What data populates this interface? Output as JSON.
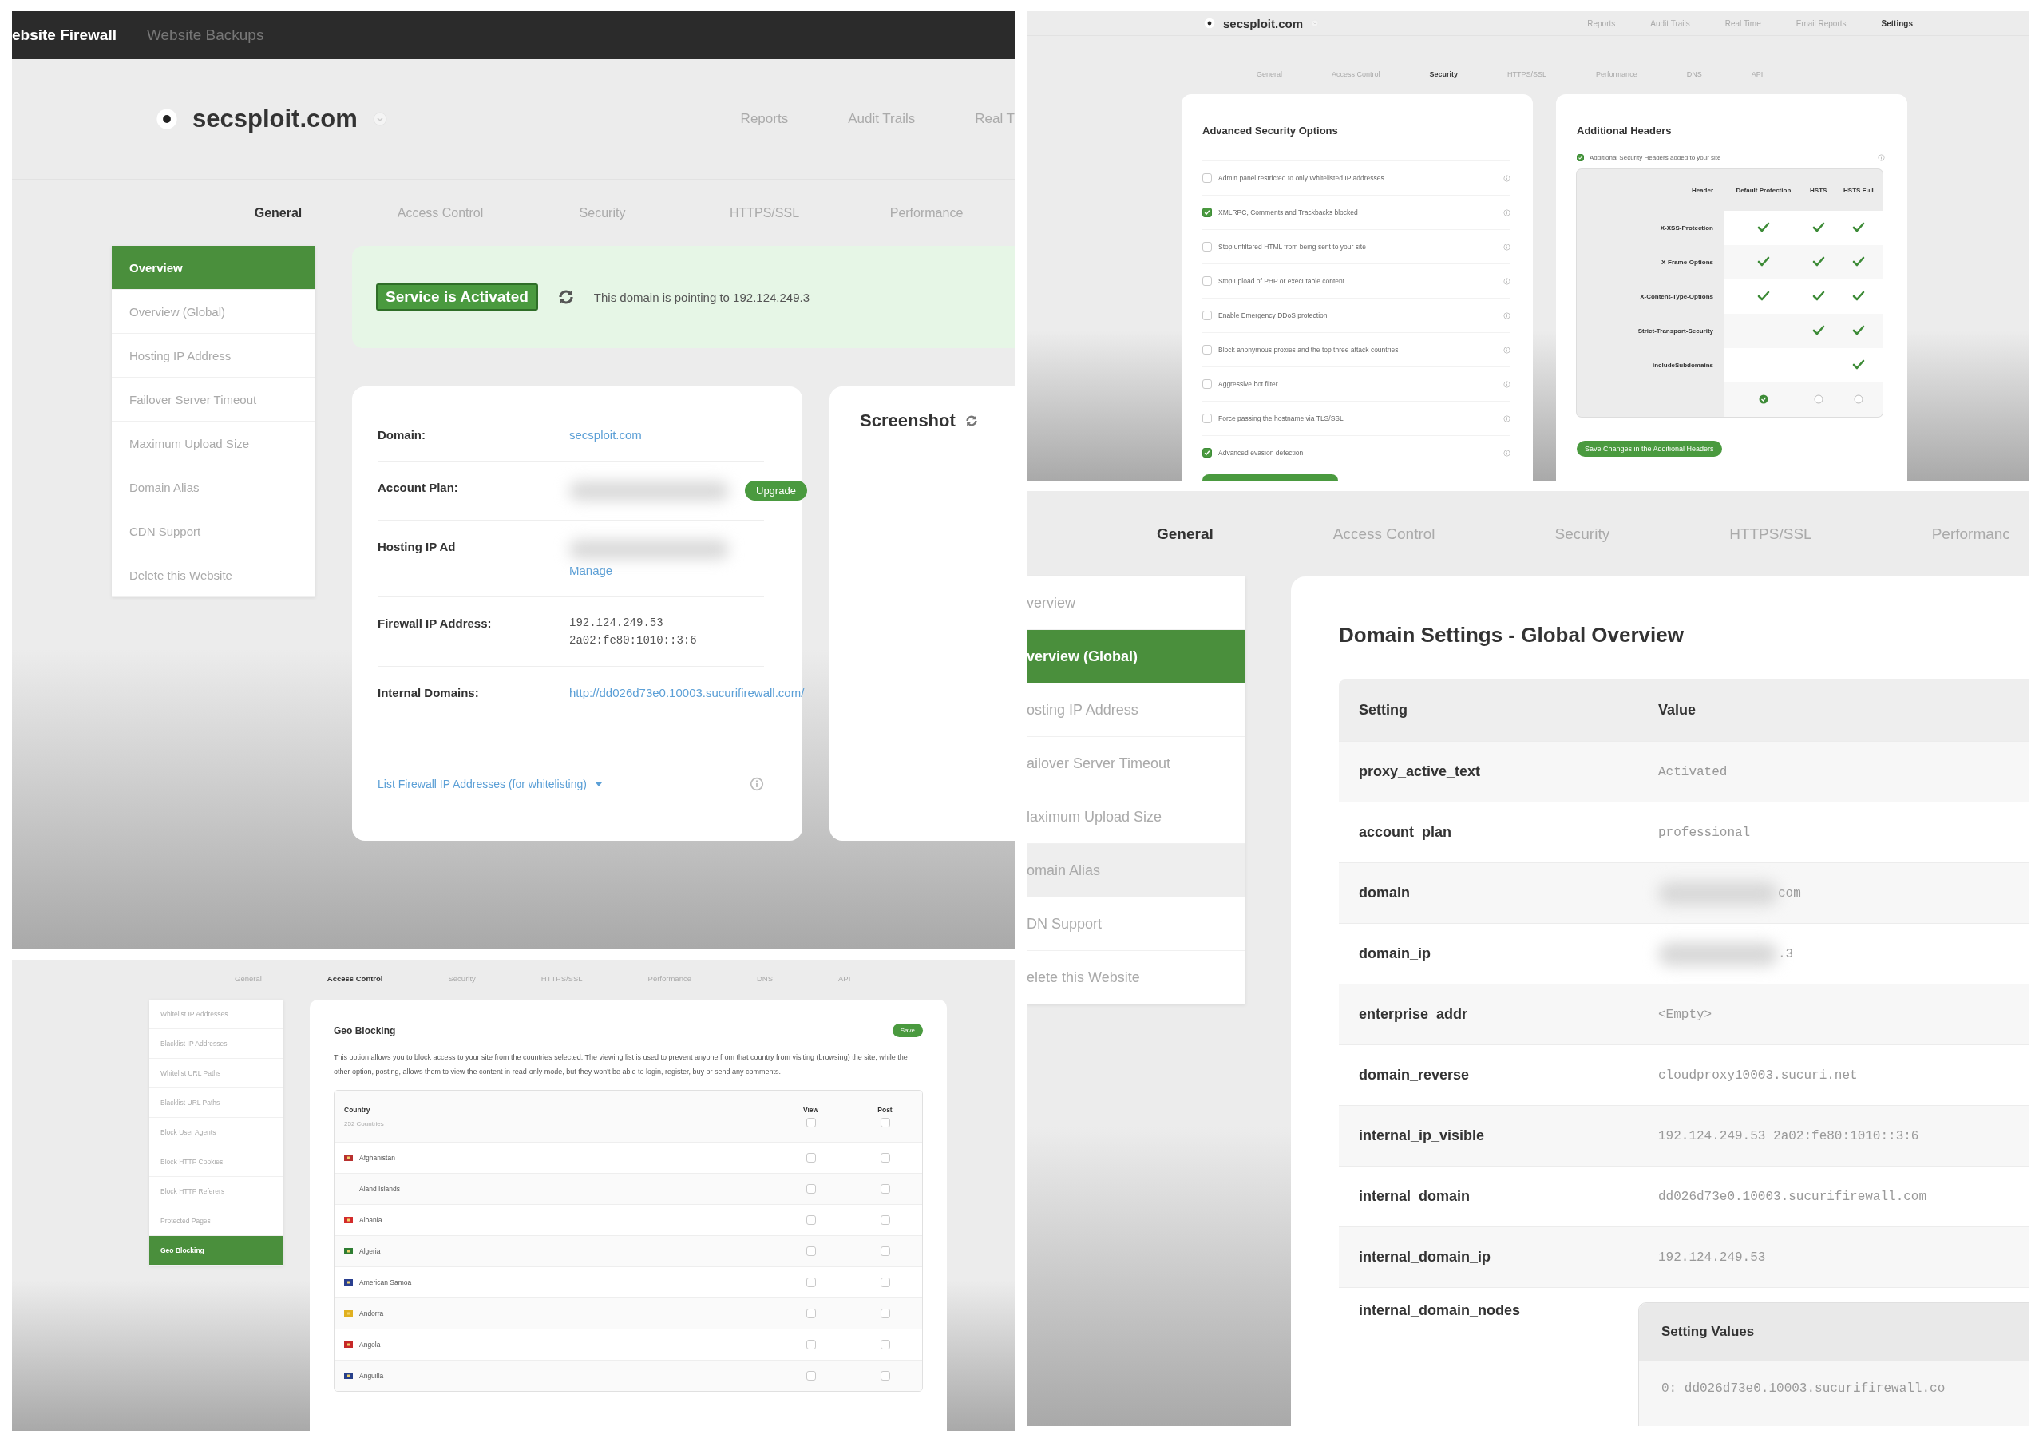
{
  "firewall_overview": {
    "top_bar": [
      {
        "label": "ebsite Firewall",
        "selected": true
      },
      {
        "label": "Website Backups",
        "selected": false
      }
    ],
    "site": "secsploit.com",
    "nav": [
      {
        "label": "Reports",
        "selected": false
      },
      {
        "label": "Audit Trails",
        "selected": false
      },
      {
        "label": "Real T",
        "selected": false
      }
    ],
    "tabs": [
      {
        "label": "General",
        "selected": true
      },
      {
        "label": "Access Control",
        "selected": false
      },
      {
        "label": "Security",
        "selected": false
      },
      {
        "label": "HTTPS/SSL",
        "selected": false
      },
      {
        "label": "Performance",
        "selected": false
      }
    ],
    "sidebar": [
      {
        "label": "Overview",
        "selected": true
      },
      {
        "label": "Overview (Global)",
        "selected": false
      },
      {
        "label": "Hosting IP Address",
        "selected": false
      },
      {
        "label": "Failover Server Timeout",
        "selected": false
      },
      {
        "label": "Maximum Upload Size",
        "selected": false
      },
      {
        "label": "Domain Alias",
        "selected": false
      },
      {
        "label": "CDN Support",
        "selected": false
      },
      {
        "label": "Delete this Website",
        "selected": false
      }
    ],
    "status": {
      "badge": "Service is Activated",
      "text": "This domain is pointing to 192.124.249.3"
    },
    "details": [
      {
        "label": "Domain:",
        "kind": "link",
        "value": "secsploit.com",
        "redacted": false
      },
      {
        "label": "Account Plan:",
        "kind": "button",
        "value": "Upgrade",
        "redacted": true
      },
      {
        "label": "Hosting IP Ad",
        "kind": "link",
        "value": "Manage",
        "redacted": true
      },
      {
        "label": "Firewall IP Address:",
        "kind": "mono",
        "lines": [
          "192.124.249.53",
          "2a02:fe80:1010::3:6"
        ],
        "redacted": false
      },
      {
        "label": "Internal Domains:",
        "kind": "link",
        "value": "http://dd026d73e0.10003.sucurifirewall.com/",
        "redacted": false
      }
    ],
    "footer_link": "List Firewall IP Addresses (for whitelisting)",
    "screenshot_title": "Screenshot"
  },
  "security_settings": {
    "site": "secsploit.com",
    "nav": [
      {
        "label": "Reports",
        "selected": false
      },
      {
        "label": "Audit Trails",
        "selected": false
      },
      {
        "label": "Real Time",
        "selected": false
      },
      {
        "label": "Email Reports",
        "selected": false
      },
      {
        "label": "Settings",
        "selected": true
      }
    ],
    "tabs": [
      {
        "label": "General",
        "selected": false
      },
      {
        "label": "Access Control",
        "selected": false
      },
      {
        "label": "Security",
        "selected": true
      },
      {
        "label": "HTTPS/SSL",
        "selected": false
      },
      {
        "label": "Performance",
        "selected": false
      },
      {
        "label": "DNS",
        "selected": false
      },
      {
        "label": "API",
        "selected": false
      }
    ],
    "advanced": {
      "title": "Advanced Security Options",
      "options": [
        {
          "label": "Admin panel restricted to only Whitelisted IP addresses",
          "checked": false
        },
        {
          "label": "XMLRPC, Comments and Trackbacks blocked",
          "checked": true
        },
        {
          "label": "Stop unfiltered HTML from being sent to your site",
          "checked": false
        },
        {
          "label": "Stop upload of PHP or executable content",
          "checked": false
        },
        {
          "label": "Enable Emergency DDoS protection",
          "checked": false
        },
        {
          "label": "Block anonymous proxies and the top three attack countries",
          "checked": false
        },
        {
          "label": "Aggressive bot filter",
          "checked": false
        },
        {
          "label": "Force passing the hostname via TLS/SSL",
          "checked": false
        },
        {
          "label": "Advanced evasion detection",
          "checked": true
        }
      ]
    },
    "headers": {
      "title": "Additional Headers",
      "option": {
        "label": "Additional Security Headers added to your site",
        "checked": true
      },
      "columns": [
        "Header",
        "Default Protection",
        "HSTS",
        "HSTS Full"
      ],
      "rows": [
        {
          "header": "X-XSS-Protection",
          "cells": [
            true,
            true,
            true
          ]
        },
        {
          "header": "X-Frame-Options",
          "cells": [
            true,
            true,
            true
          ]
        },
        {
          "header": "X-Content-Type-Options",
          "cells": [
            true,
            true,
            true
          ]
        },
        {
          "header": "Strict-Transport-Security",
          "cells": [
            false,
            true,
            true
          ]
        },
        {
          "header": "includeSubdomains",
          "cells": [
            false,
            false,
            true
          ]
        }
      ],
      "levels": [
        {
          "selected": true
        },
        {
          "selected": false
        },
        {
          "selected": false
        }
      ],
      "button": "Save Changes in the Additional Headers"
    }
  },
  "access_control": {
    "tabs": [
      {
        "label": "General",
        "selected": false
      },
      {
        "label": "Access Control",
        "selected": true
      },
      {
        "label": "Security",
        "selected": false
      },
      {
        "label": "HTTPS/SSL",
        "selected": false
      },
      {
        "label": "Performance",
        "selected": false
      },
      {
        "label": "DNS",
        "selected": false
      },
      {
        "label": "API",
        "selected": false
      }
    ],
    "sidebar": [
      {
        "label": "Whitelist IP Addresses",
        "selected": false
      },
      {
        "label": "Blacklist IP Addresses",
        "selected": false
      },
      {
        "label": "Whitelist URL Paths",
        "selected": false
      },
      {
        "label": "Blacklist URL Paths",
        "selected": false
      },
      {
        "label": "Block User Agents",
        "selected": false
      },
      {
        "label": "Block HTTP Cookies",
        "selected": false
      },
      {
        "label": "Block HTTP Referers",
        "selected": false
      },
      {
        "label": "Protected Pages",
        "selected": false
      },
      {
        "label": "Geo Blocking",
        "selected": true
      }
    ],
    "title": "Geo Blocking",
    "save": "Save",
    "description": "This option allows you to block access to your site from the countries selected. The viewing list is used to prevent anyone from that country from visiting (browsing) the site, while the other option, posting, allows them to view the content in read-only mode, but they won't be able to login, register, buy or send any comments.",
    "table": {
      "country": "Country",
      "count": "252 Countries",
      "view": "View",
      "post": "Post",
      "view_all": false,
      "post_all": false,
      "rows": [
        {
          "country": "Afghanistan",
          "color": "#b8312f",
          "view": false,
          "post": false
        },
        {
          "country": "Aland Islands",
          "view": false,
          "post": false
        },
        {
          "country": "Albania",
          "color": "#d32b2b",
          "view": false,
          "post": false
        },
        {
          "country": "Algeria",
          "color": "#2e7d32",
          "view": false,
          "post": false
        },
        {
          "country": "American Samoa",
          "color": "#2a3f8f",
          "view": false,
          "post": false
        },
        {
          "country": "Andorra",
          "color": "#e0b020",
          "view": false,
          "post": false
        },
        {
          "country": "Angola",
          "color": "#c62828",
          "view": false,
          "post": false
        },
        {
          "country": "Anguilla",
          "color": "#27408b",
          "view": false,
          "post": false
        }
      ]
    }
  },
  "global_overview": {
    "tabs": [
      {
        "label": "General",
        "selected": true
      },
      {
        "label": "Access Control",
        "selected": false
      },
      {
        "label": "Security",
        "selected": false
      },
      {
        "label": "HTTPS/SSL",
        "selected": false
      },
      {
        "label": "Performanc",
        "selected": false
      }
    ],
    "sidebar": [
      {
        "label": "verview",
        "selected": false,
        "hovered": false
      },
      {
        "label": "verview (Global)",
        "selected": true,
        "hovered": false
      },
      {
        "label": "osting IP Address",
        "selected": false,
        "hovered": false
      },
      {
        "label": "ailover Server Timeout",
        "selected": false,
        "hovered": false
      },
      {
        "label": "laximum Upload Size",
        "selected": false,
        "hovered": false
      },
      {
        "label": "omain Alias",
        "selected": false,
        "hovered": true
      },
      {
        "label": "DN Support",
        "selected": false,
        "hovered": false
      },
      {
        "label": "elete this Website",
        "selected": false,
        "hovered": false
      }
    ],
    "title": "Domain Settings - Global Overview",
    "columns": [
      "Setting",
      "Value"
    ],
    "rows": [
      {
        "setting": "proxy_active_text",
        "value": "Activated",
        "redacted": false
      },
      {
        "setting": "account_plan",
        "value": "professional",
        "redacted": false
      },
      {
        "setting": "domain",
        "value": "com",
        "redacted": true
      },
      {
        "setting": "domain_ip",
        "value": ".3",
        "redacted": true
      },
      {
        "setting": "enterprise_addr",
        "value": "<Empty>",
        "redacted": false
      },
      {
        "setting": "domain_reverse",
        "value": "cloudproxy10003.sucuri.net",
        "redacted": false
      },
      {
        "setting": "internal_ip_visible",
        "value": "192.124.249.53 2a02:fe80:1010::3:6",
        "redacted": false
      },
      {
        "setting": "internal_domain",
        "value": "dd026d73e0.10003.sucurifirewall.com",
        "redacted": false
      },
      {
        "setting": "internal_domain_ip",
        "value": "192.124.249.53",
        "redacted": false
      }
    ],
    "nodes": {
      "setting": "internal_domain_nodes",
      "header": "Setting Values",
      "values": [
        "0: dd026d73e0.10003.sucurifirewall.co"
      ]
    }
  }
}
